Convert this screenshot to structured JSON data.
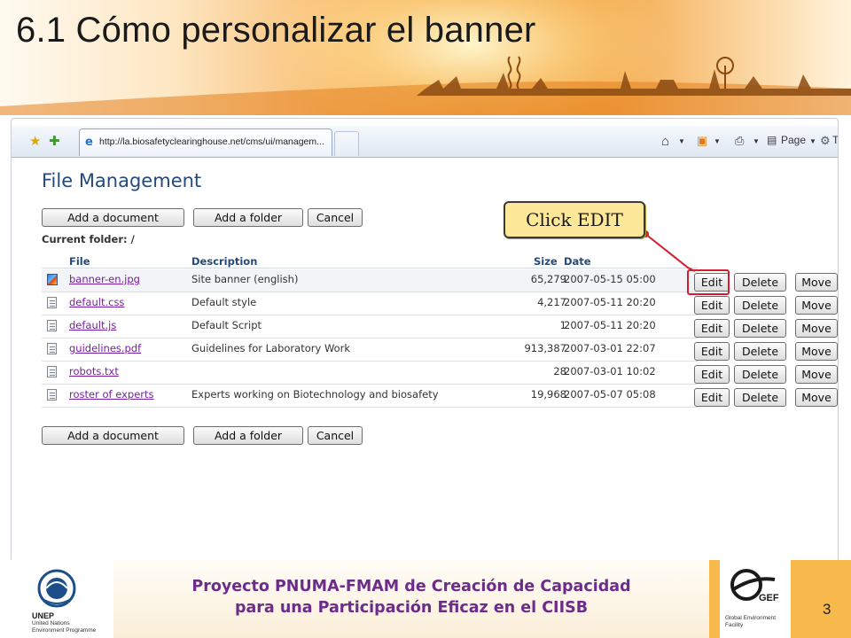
{
  "slide": {
    "title": "6.1  Cómo personalizar el banner",
    "page_number": "3",
    "footer_line1": "Proyecto PNUMA-FMAM de Creación de Capacidad",
    "footer_line2": "para una Participación Eficaz en el CIISB"
  },
  "logos": {
    "unep": {
      "name": "UNEP",
      "sub_line1": "United Nations",
      "sub_line2": "Environment Programme"
    },
    "gef": {
      "name": "GEF",
      "sub_line1": "Global Environment",
      "sub_line2": "Facility"
    }
  },
  "browser": {
    "tab_url": "http://la.biosafetyclearinghouse.net/cms/ui/managem...",
    "page_menu": "Page",
    "tools_menu": "To",
    "icons": [
      "favorites-star-icon",
      "add-favorites-icon",
      "ie-icon",
      "home-icon",
      "rss-feed-icon",
      "print-icon",
      "page-icon",
      "tools-gear-icon"
    ]
  },
  "page": {
    "heading": "File Management",
    "current_folder_label": "Current folder: /",
    "buttons": {
      "add_document": "Add a document",
      "add_folder": "Add a folder",
      "cancel": "Cancel"
    },
    "columns": {
      "file": "File",
      "description": "Description",
      "size": "Size",
      "date": "Date"
    },
    "row_actions": {
      "edit": "Edit",
      "delete": "Delete",
      "move": "Move"
    },
    "files": [
      {
        "name": "banner-en.jpg",
        "description": "Site banner (english)",
        "size": "65,279",
        "date": "2007-05-15 05:00",
        "icon": "image-file-icon"
      },
      {
        "name": "default.css",
        "description": "Default style",
        "size": "4,217",
        "date": "2007-05-11 20:20",
        "icon": "document-file-icon"
      },
      {
        "name": "default.js",
        "description": "Default Script",
        "size": "1",
        "date": "2007-05-11 20:20",
        "icon": "document-file-icon"
      },
      {
        "name": "guidelines.pdf",
        "description": "Guidelines for Laboratory Work",
        "size": "913,387",
        "date": "2007-03-01 22:07",
        "icon": "document-file-icon"
      },
      {
        "name": "robots.txt",
        "description": "",
        "size": "28",
        "date": "2007-03-01 10:02",
        "icon": "document-file-icon"
      },
      {
        "name": "roster of experts",
        "description": "Experts working on Biotechnology and biosafety",
        "size": "19,968",
        "date": "2007-05-07 05:08",
        "icon": "document-file-icon"
      }
    ]
  },
  "callout": {
    "text": "Click EDIT"
  },
  "colors": {
    "heading_blue": "#244a7a",
    "link_purple": "#7a1ea1",
    "footer_purple": "#6d2c8a",
    "callout_fill": "#fde89a",
    "highlight_red": "#d21e2e",
    "banner_orange": "#f19a35"
  }
}
